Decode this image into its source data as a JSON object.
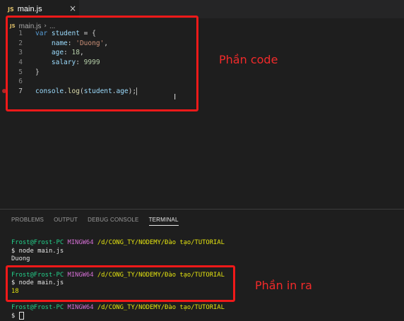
{
  "tab": {
    "label": "main.js",
    "badge": "JS",
    "close": "×"
  },
  "breadcrumb": {
    "badge": "JS",
    "file": "main.js",
    "sep": "›",
    "more": "..."
  },
  "code_lines": [
    {
      "num": "1",
      "tokens": [
        [
          "kw",
          "var "
        ],
        [
          "var",
          "student"
        ],
        [
          "punc",
          " = {"
        ]
      ]
    },
    {
      "num": "2",
      "tokens": [
        [
          "var",
          "    name"
        ],
        [
          "punc",
          ": "
        ],
        [
          "str",
          "'Duong'"
        ],
        [
          "punc",
          ","
        ]
      ]
    },
    {
      "num": "3",
      "tokens": [
        [
          "var",
          "    age"
        ],
        [
          "punc",
          ": "
        ],
        [
          "num",
          "18"
        ],
        [
          "punc",
          ","
        ]
      ]
    },
    {
      "num": "4",
      "tokens": [
        [
          "var",
          "    salary"
        ],
        [
          "punc",
          ": "
        ],
        [
          "num",
          "9999"
        ]
      ]
    },
    {
      "num": "5",
      "tokens": [
        [
          "punc",
          "}"
        ]
      ]
    },
    {
      "num": "6",
      "tokens": []
    },
    {
      "num": "7",
      "tokens": [
        [
          "var",
          "console"
        ],
        [
          "punc",
          "."
        ],
        [
          "fn",
          "log"
        ],
        [
          "punc",
          "("
        ],
        [
          "var",
          "student"
        ],
        [
          "punc",
          "."
        ],
        [
          "var",
          "age"
        ],
        [
          "punc",
          ");"
        ]
      ]
    }
  ],
  "annotations": {
    "code_label": "Phần code",
    "output_label": "Phần in ra"
  },
  "panel": {
    "tabs": [
      "PROBLEMS",
      "OUTPUT",
      "DEBUG CONSOLE",
      "TERMINAL"
    ],
    "active_tab": "TERMINAL"
  },
  "terminal": {
    "user": "Frost@Frost-PC",
    "shell": "MINGW64",
    "path": "/d/CONG_TY/NODEMY/Đào tạo/TUTORIAL",
    "command": "$ node main.js",
    "output1": "Duong",
    "output2": "18",
    "prompt": "$"
  },
  "colors": {
    "annotation": "#f01919",
    "background": "#1e1e1e",
    "term_green": "#23d18b",
    "term_magenta": "#d670d6",
    "term_yellow": "#e5e510"
  }
}
